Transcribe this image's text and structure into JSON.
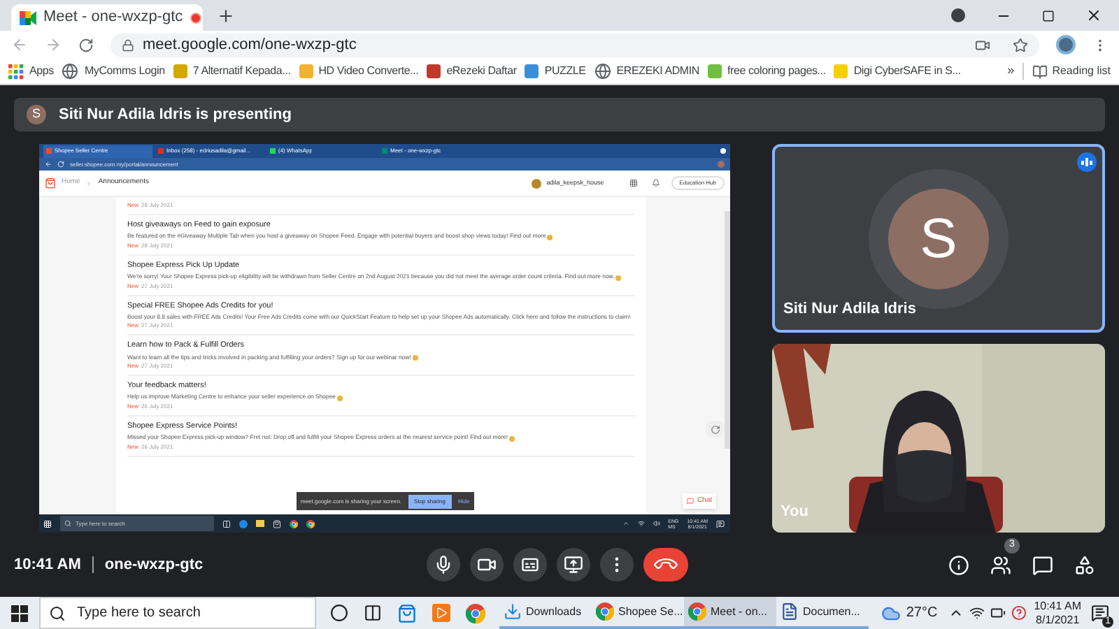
{
  "browser": {
    "tab": {
      "title": "Meet - one-wxzp-gtc",
      "recording": true
    },
    "url": "meet.google.com/one-wxzp-gtc",
    "bookmarks": [
      {
        "label": "Apps",
        "kind": "apps"
      },
      {
        "label": "MyComms Login",
        "kind": "globe"
      },
      {
        "label": "7 Alternatif Kepada...",
        "kind": "site",
        "color": "#d4a800"
      },
      {
        "label": "HD Video Converte...",
        "kind": "site",
        "color": "#f2b233"
      },
      {
        "label": "eRezeki Daftar",
        "kind": "site",
        "color": "#c0392b"
      },
      {
        "label": "PUZZLE",
        "kind": "site",
        "color": "#3b8fd9"
      },
      {
        "label": "EREZEKI ADMIN",
        "kind": "globe"
      },
      {
        "label": "free coloring pages...",
        "kind": "site",
        "color": "#6fbf40"
      },
      {
        "label": "Digi CyberSAFE in S...",
        "kind": "site",
        "color": "#f5d000"
      }
    ],
    "overflow": "»",
    "reading_list": "Reading list"
  },
  "banner": {
    "avatar": "S",
    "text": "Siti Nur Adila Idris is presenting"
  },
  "shared_screen": {
    "tabs": [
      {
        "title": "Shopee Seller Centre",
        "selected": true,
        "color": "#ee4d2d"
      },
      {
        "title": "Inbox (258) - edriusadila@gmail...",
        "selected": false,
        "color": "#d93025"
      },
      {
        "title": "(4) WhatsApp",
        "selected": false,
        "color": "#25d366"
      },
      {
        "title": "Meet - one-wxzp-gtc",
        "selected": false,
        "color": "#00897b"
      }
    ],
    "url": "seller.shopee.com.my/portal/announcement",
    "home": "Home",
    "current": "Announcements",
    "shop": "adila_keepsk_house",
    "hub": "Education Hub",
    "announcements": [
      {
        "badge": "New",
        "date": "28 July 2021"
      },
      {
        "title": "Host giveaways on Feed to gain exposure",
        "body": "Be featured on the #Giveaway Multiple Tab when you host a giveaway on Shopee Feed. Engage with potential buyers and boost shop views today! Find out more",
        "badge": "New",
        "date": "28 July 2021",
        "emoji": true
      },
      {
        "title": "Shopee Express Pick Up Update",
        "body": "We're sorry! Your Shopee Express pick-up eligibility will be withdrawn from Seller Centre on 2nd August 2021 because you did not meet the average order count criteria. Find out more now.",
        "badge": "New",
        "date": "27 July 2021",
        "emoji": true
      },
      {
        "title": "Special FREE Shopee Ads Credits for you!",
        "body": "Boost your 8.8 sales with FREE Ads Credits! Your Free Ads Credits come with our QuickStart Feature to help set up your Shopee Ads automatically. Click here and follow the instructions to claim!",
        "badge": "New",
        "date": "27 July 2021",
        "emoji": false
      },
      {
        "title": "Learn how to Pack & Fulfill Orders",
        "body": "Want to learn all the tips and tricks involved in packing and fulfilling your orders? Sign up for our webinar now!",
        "badge": "New",
        "date": "27 July 2021",
        "emoji": true
      },
      {
        "title": "Your feedback matters!",
        "body": "Help us improve Marketing Centre to enhance your seller experience on Shopee",
        "badge": "New",
        "date": "26 July 2021",
        "emoji": true
      },
      {
        "title": "Shopee Express Service Points!",
        "body": "Missed your Shopee Express pick-up window? Fret not: Drop off and fulfill your Shopee Express orders at the nearest service point! Find out more!",
        "badge": "New",
        "date": "26 July 2021",
        "emoji": true
      }
    ],
    "sharing": {
      "text": "meet.google.com is sharing your screen.",
      "stop": "Stop sharing",
      "hide": "Hide"
    },
    "chat": "Chat",
    "taskbar": {
      "search": "Type here to search",
      "lang": "ENG",
      "region": "MS",
      "time": "10:41 AM",
      "date": "8/1/2021"
    }
  },
  "tiles": [
    {
      "kind": "avatar",
      "name": "Siti Nur Adila Idris",
      "avatar": "S",
      "speaking": true
    },
    {
      "kind": "camera",
      "name": "You"
    }
  ],
  "bottom": {
    "time": "10:41 AM",
    "code": "one-wxzp-gtc",
    "controls": [
      {
        "kind": "mic"
      },
      {
        "kind": "camera"
      },
      {
        "kind": "captions"
      },
      {
        "kind": "present"
      },
      {
        "kind": "more"
      },
      {
        "kind": "hangup"
      }
    ],
    "side": [
      {
        "kind": "info"
      },
      {
        "kind": "people",
        "badge": "3"
      },
      {
        "kind": "chat"
      },
      {
        "kind": "activities"
      }
    ]
  },
  "taskbar": {
    "search": "Type here to search",
    "pins": [
      {
        "kind": "cortana"
      },
      {
        "kind": "taskview"
      },
      {
        "kind": "store"
      },
      {
        "kind": "media"
      },
      {
        "kind": "chrome"
      }
    ],
    "apps": [
      {
        "label": "Downloads",
        "kind": "folder",
        "selected": false
      },
      {
        "label": "Shopee Se...",
        "kind": "chrome",
        "selected": false
      },
      {
        "label": "Meet - on...",
        "kind": "chrome",
        "selected": true
      },
      {
        "label": "Documen...",
        "kind": "word",
        "selected": false
      }
    ],
    "temp": "27°C",
    "time": "10:41 AM",
    "date": "8/1/2021",
    "notifications": "1"
  }
}
